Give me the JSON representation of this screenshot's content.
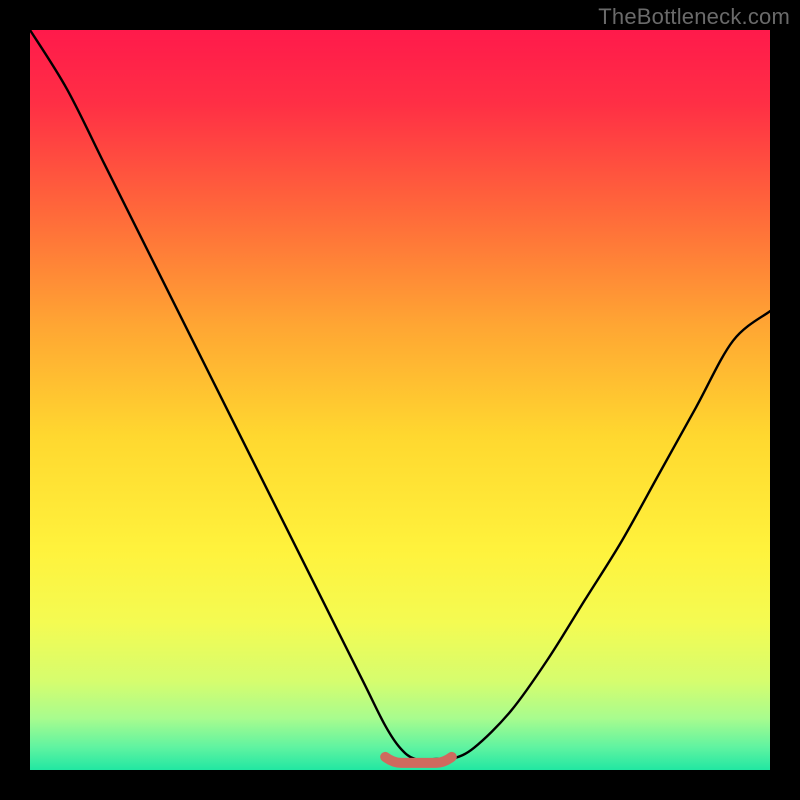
{
  "watermark": "TheBottleneck.com",
  "colors": {
    "frame": "#000000",
    "watermark": "#6a6a6a",
    "curve": "#000000",
    "accent": "#cf6a5e",
    "gradient_stops": [
      {
        "offset": 0.0,
        "color": "#ff1a4b"
      },
      {
        "offset": 0.1,
        "color": "#ff2f45"
      },
      {
        "offset": 0.25,
        "color": "#ff6a3a"
      },
      {
        "offset": 0.4,
        "color": "#ffa633"
      },
      {
        "offset": 0.55,
        "color": "#ffd82f"
      },
      {
        "offset": 0.7,
        "color": "#fff23c"
      },
      {
        "offset": 0.8,
        "color": "#f4fb52"
      },
      {
        "offset": 0.88,
        "color": "#d6fd6e"
      },
      {
        "offset": 0.93,
        "color": "#a8fc8e"
      },
      {
        "offset": 0.97,
        "color": "#5ef3a1"
      },
      {
        "offset": 1.0,
        "color": "#21e7a2"
      }
    ]
  },
  "chart_data": {
    "type": "line",
    "title": "",
    "xlabel": "",
    "ylabel": "",
    "xlim": [
      0,
      100
    ],
    "ylim": [
      0,
      100
    ],
    "grid": false,
    "legend": false,
    "series": [
      {
        "name": "bottleneck-curve",
        "x": [
          0,
          5,
          10,
          15,
          20,
          25,
          30,
          35,
          40,
          45,
          48,
          50,
          52,
          55,
          57,
          60,
          65,
          70,
          75,
          80,
          85,
          90,
          95,
          100
        ],
        "y": [
          100,
          92,
          82,
          72,
          62,
          52,
          42,
          32,
          22,
          12,
          6,
          3,
          1.5,
          1.5,
          1.5,
          3,
          8,
          15,
          23,
          31,
          40,
          49,
          58,
          62
        ]
      },
      {
        "name": "optimal-flat-segment",
        "x": [
          48,
          57
        ],
        "y": [
          1.5,
          1.5
        ]
      }
    ],
    "annotations": []
  }
}
